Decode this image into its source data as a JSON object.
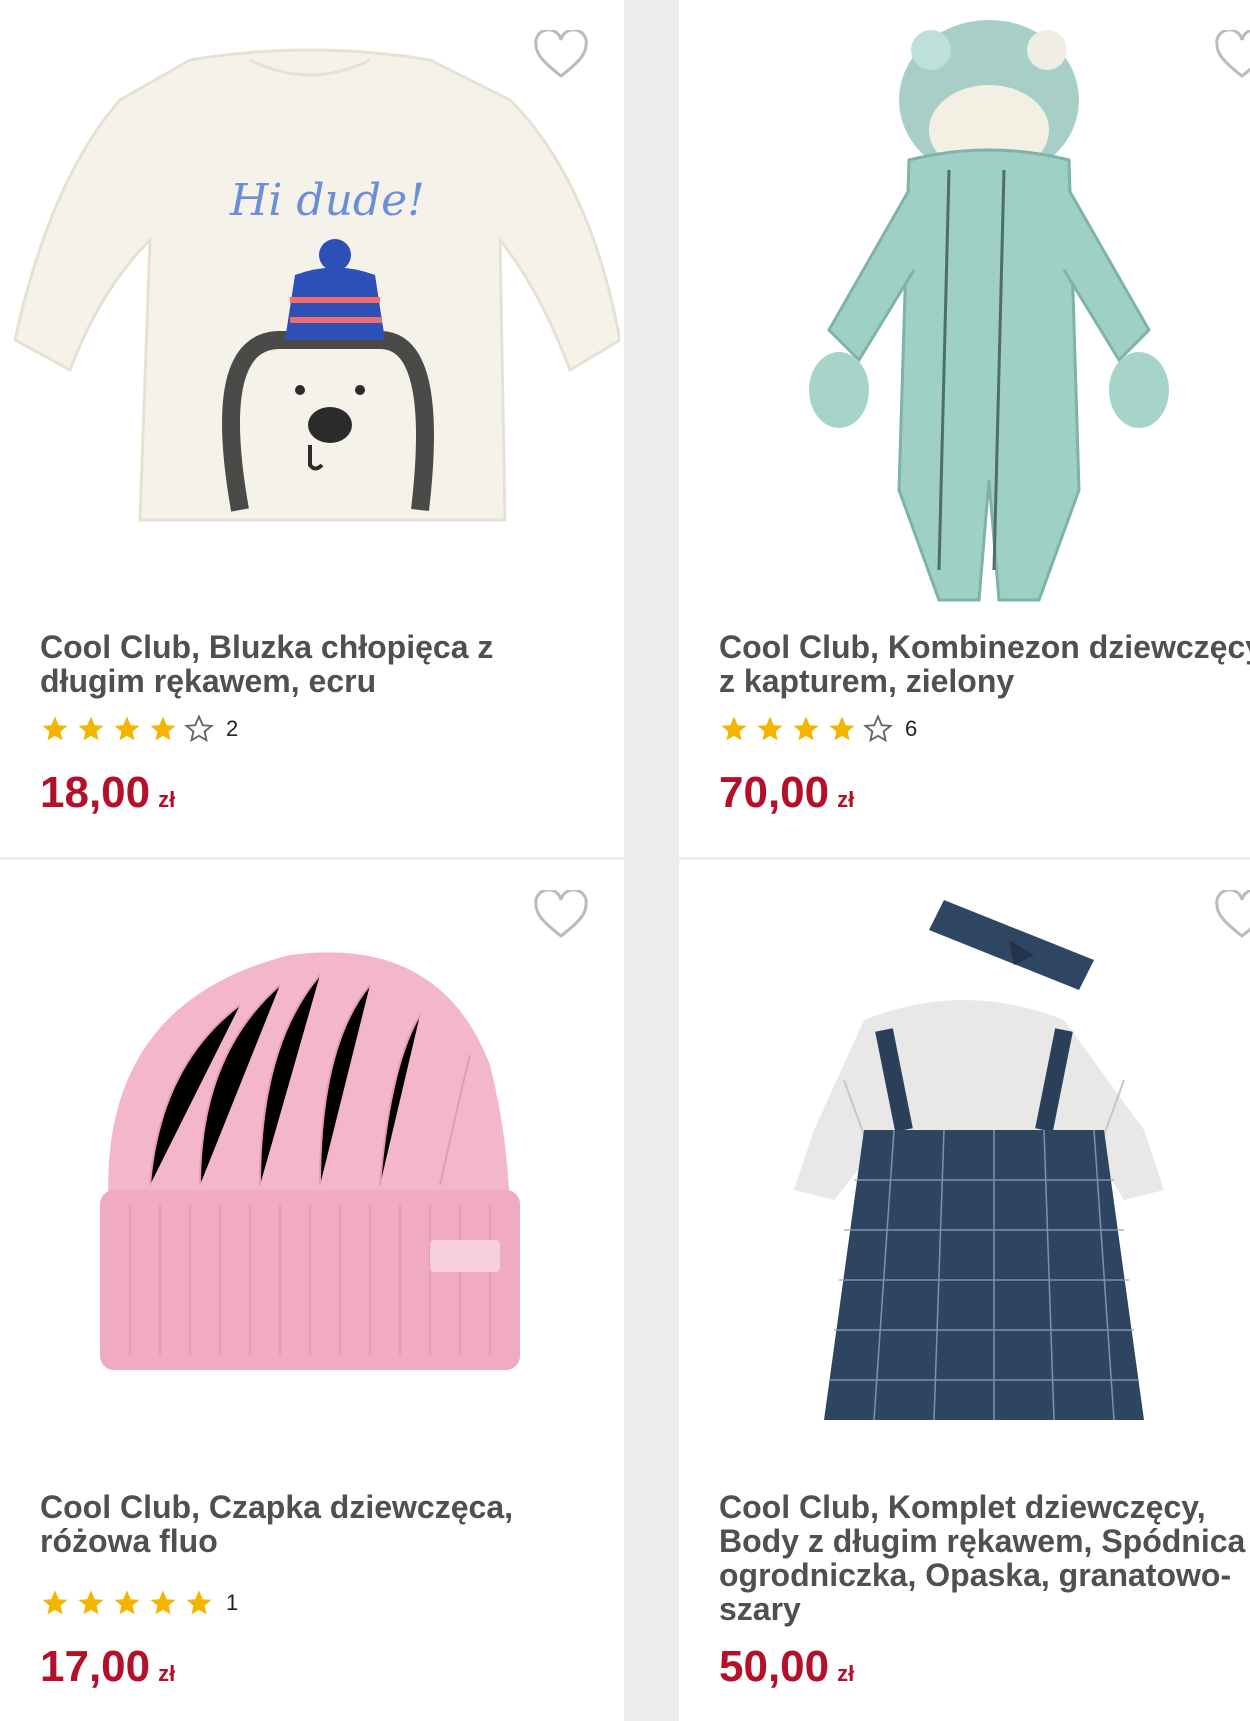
{
  "products": [
    {
      "title": "Cool Club, Bluzka chłopięca z długim rękawem, ecru",
      "rating": 4,
      "reviews": "2",
      "price": "18,00",
      "currency": "zł",
      "image": "ecru-long-sleeve-shirt-bear",
      "image_text": "Hi dude!"
    },
    {
      "title": "Cool Club, Kombinezon dziewczęcy z kapturem, zielony",
      "rating": 4,
      "reviews": "6",
      "price": "70,00",
      "currency": "zł",
      "image": "green-hooded-snowsuit"
    },
    {
      "title": "Cool Club, Czapka dziewczęca, różowa fluo",
      "rating": 5,
      "reviews": "1",
      "price": "17,00",
      "currency": "zł",
      "image": "pink-knit-beanie"
    },
    {
      "title": "Cool Club, Komplet dziewczęcy, Body z długim rękawem, Spódnica ogrodniczka, Opaska, granatowo-szary",
      "rating": 0,
      "reviews": "",
      "price": "50,00",
      "currency": "zł",
      "image": "navy-pinafore-dress-set"
    }
  ],
  "colors": {
    "price": "#b3102a",
    "star": "#f4b400",
    "text": "#505050"
  }
}
